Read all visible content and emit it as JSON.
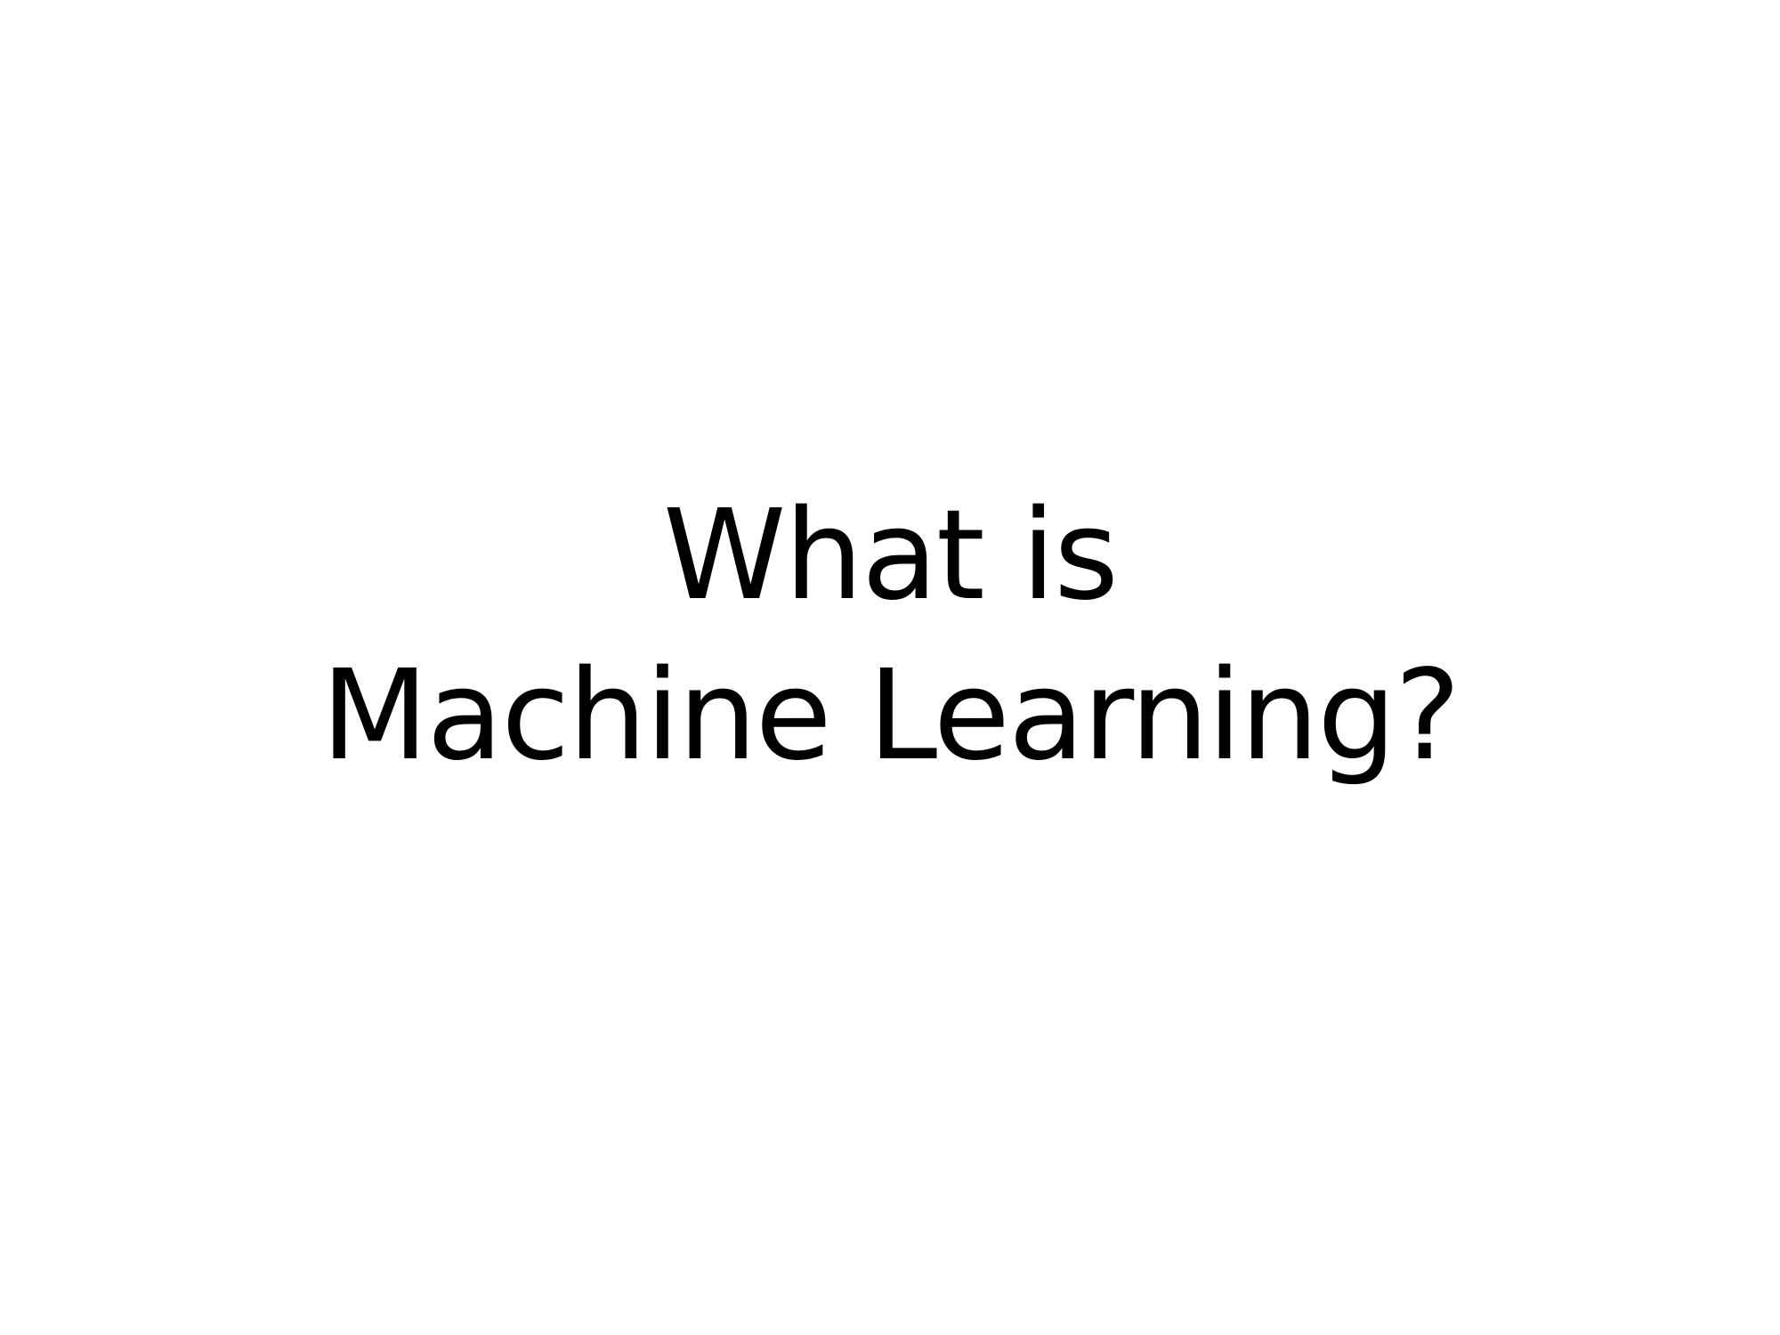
{
  "slide": {
    "title_line_1": "What is",
    "title_line_2": "Machine Learning?"
  }
}
